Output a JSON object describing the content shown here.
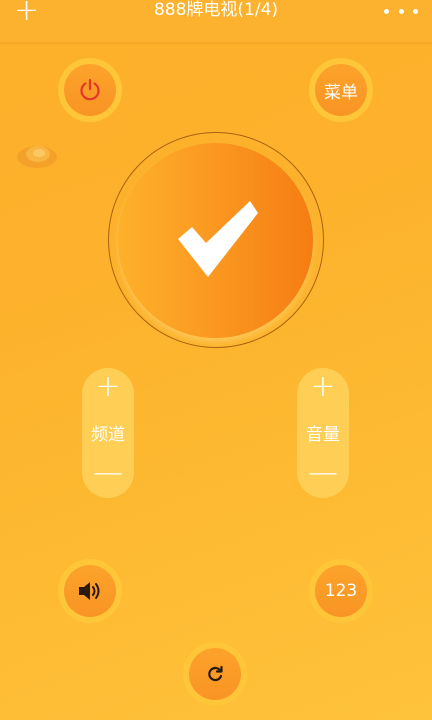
{
  "header": {
    "add_symbol": "+",
    "title": "888牌电视(1/4)"
  },
  "controls": {
    "power_icon": "power-icon",
    "menu_label": "菜单",
    "ok_icon": "checkmark-icon",
    "channel": {
      "plus": "+",
      "label": "频道",
      "minus": "—"
    },
    "volume": {
      "plus": "+",
      "label": "音量",
      "minus": "—"
    },
    "mute_icon": "speaker-icon",
    "numpad_label": "123",
    "back_icon": "refresh-icon"
  },
  "colors": {
    "background": "#fdb22f",
    "button_inner": "#fa9a26",
    "button_ring": "#ffc63a",
    "pill": "#ffcf55",
    "ok_gradient_end": "#f57d12"
  }
}
